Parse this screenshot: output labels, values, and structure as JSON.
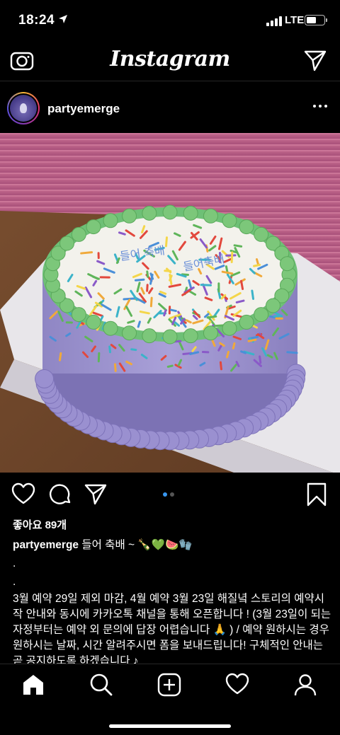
{
  "status": {
    "time": "18:24",
    "network": "LTE",
    "battery_level": 0.55
  },
  "nav": {
    "title": "Instagram"
  },
  "post": {
    "username": "partyemerge",
    "likes": "좋아요 89개",
    "caption_username": "partyemerge",
    "caption_first": "들어 축배 ~ 🍾💚🍉🧤",
    "caption_dots": [
      ".",
      "."
    ],
    "caption_body": "3월 예약 29일 제외 마감, 4월 예약 3월 23일 해질녘 스토리의 예약시작 안내와 동시에 카카오톡 채널을 통해 오픈합니다 ! (3월 23일이 되는 자정부터는 예약 외 문의에 답장 어렵습니다 🙏 ) / 예약 원하시는 경우 원하시는 날짜, 시간 알려주시면 폼을 보내드립니다! 구체적인 안내는 곧 공지하도록 하겠습니다 ♪",
    "image_text": "들어 축배 들어 축배",
    "carousel": {
      "count": 2,
      "active": 1
    }
  },
  "icons": {
    "status": [
      "location-arrow-icon",
      "signal-icon",
      "battery-icon"
    ],
    "top_nav": [
      "camera-icon",
      "direct-send-icon"
    ],
    "post_header": [
      "more-options-icon"
    ],
    "actions": [
      "heart-icon",
      "comment-icon",
      "share-icon",
      "bookmark-icon"
    ],
    "tabs": [
      "home-icon",
      "search-icon",
      "new-post-icon",
      "activity-icon",
      "profile-icon"
    ]
  }
}
